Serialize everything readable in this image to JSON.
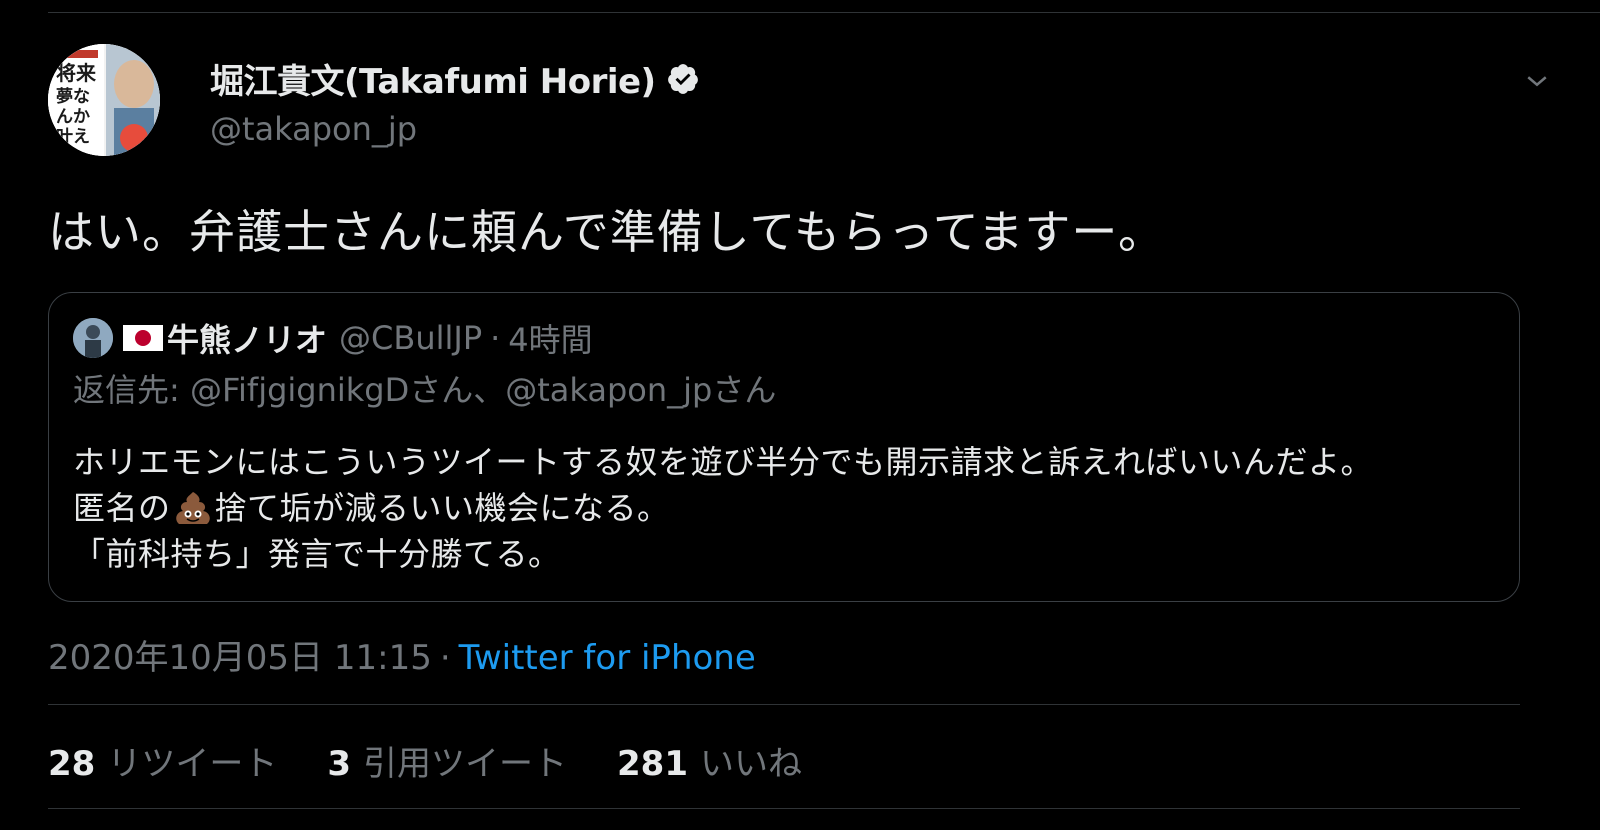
{
  "tweet": {
    "author": {
      "display_name": "堀江貴文(Takafumi Horie)",
      "handle": "@takapon_jp",
      "verified": true,
      "avatar_text": "将来の夢なんか、いま叶えろ。"
    },
    "more_icon": "chevron-down-icon",
    "text": "はい。弁護士さんに頼んで準備してもらってますー。",
    "timestamp": "2020年10月05日 11:15",
    "separator": "·",
    "source": "Twitter for iPhone",
    "stats": [
      {
        "count": "28",
        "label": "リツイート"
      },
      {
        "count": "3",
        "label": "引用ツイート"
      },
      {
        "count": "281",
        "label": "いいね"
      }
    ]
  },
  "quoted_tweet": {
    "name": "牛熊ノリオ",
    "handle": "@CBullJP",
    "separator": "·",
    "time": "4時間",
    "flag_icon": "japan-flag-icon",
    "replying_to": "返信先: @FifjgignikgDさん、@takapon_jpさん",
    "body_line1": "ホリエモンにはこういうツイートする奴を遊び半分でも開示請求と訴えればいいんだよ。",
    "body_line2_before": "匿名の",
    "body_line2_emoji": "pile-of-poo-emoji",
    "body_line2_after": "捨て垢が減るいい機会になる。",
    "body_line3": "「前科持ち」発言で十分勝てる。"
  },
  "colors": {
    "background": "#000000",
    "text": "#e7e9ea",
    "secondary": "#71767b",
    "link": "#1d9bf0",
    "border": "#2f3336"
  }
}
